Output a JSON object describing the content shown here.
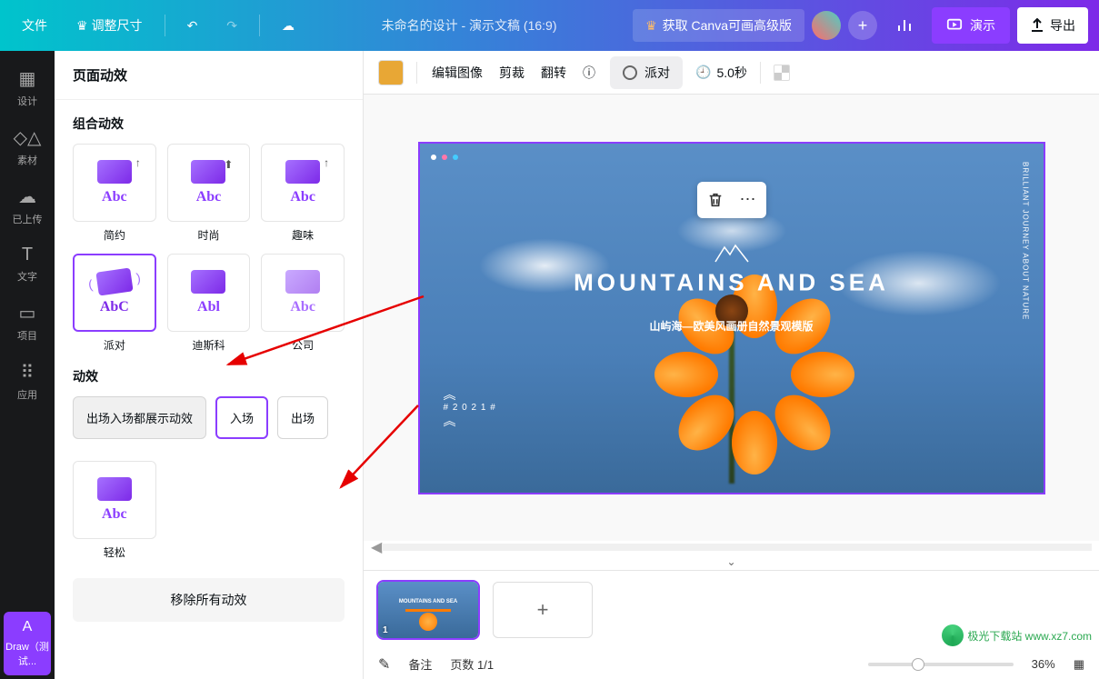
{
  "header": {
    "file": "文件",
    "resize": "调整尺寸",
    "title": "未命名的设计 - 演示文稿 (16:9)",
    "premium": "获取 Canva可画高级版",
    "present": "演示",
    "export": "导出"
  },
  "rail": {
    "design": "设计",
    "elements": "素材",
    "uploads": "已上传",
    "text": "文字",
    "projects": "项目",
    "apps": "应用",
    "draw": "Draw（测试..."
  },
  "panel": {
    "title": "页面动效",
    "combo_title": "组合动效",
    "effects": {
      "simple": "简约",
      "fashion": "时尚",
      "fun": "趣味",
      "party": "派对",
      "disco": "迪斯科",
      "company": "公司",
      "easy": "轻松"
    },
    "effect_abc": "Abc",
    "effect_abc_party": "AbC",
    "effect_abc_disco": "Abl",
    "motion_title": "动效",
    "seg_both": "出场入场都展示动效",
    "seg_in": "入场",
    "seg_out": "出场",
    "remove_all": "移除所有动效"
  },
  "ctx": {
    "edit_image": "编辑图像",
    "crop": "剪裁",
    "flip": "翻转",
    "anim_chip": "派对",
    "timing": "5.0秒"
  },
  "slide": {
    "title": "MOUNTAINS AND SEA",
    "subtitle": "山屿海—欧美风画册自然景观模版",
    "side": "BRILLIANT JOURNEY ABOUT NATURE",
    "year": "# 2 0 2 1 #",
    "thumb_title": "MOUNTAINS AND SEA"
  },
  "footer": {
    "notes": "备注",
    "pages": "页数 1/1",
    "zoom": "36%",
    "thumb_num": "1"
  },
  "watermark": "极光下载站  www.xz7.com"
}
